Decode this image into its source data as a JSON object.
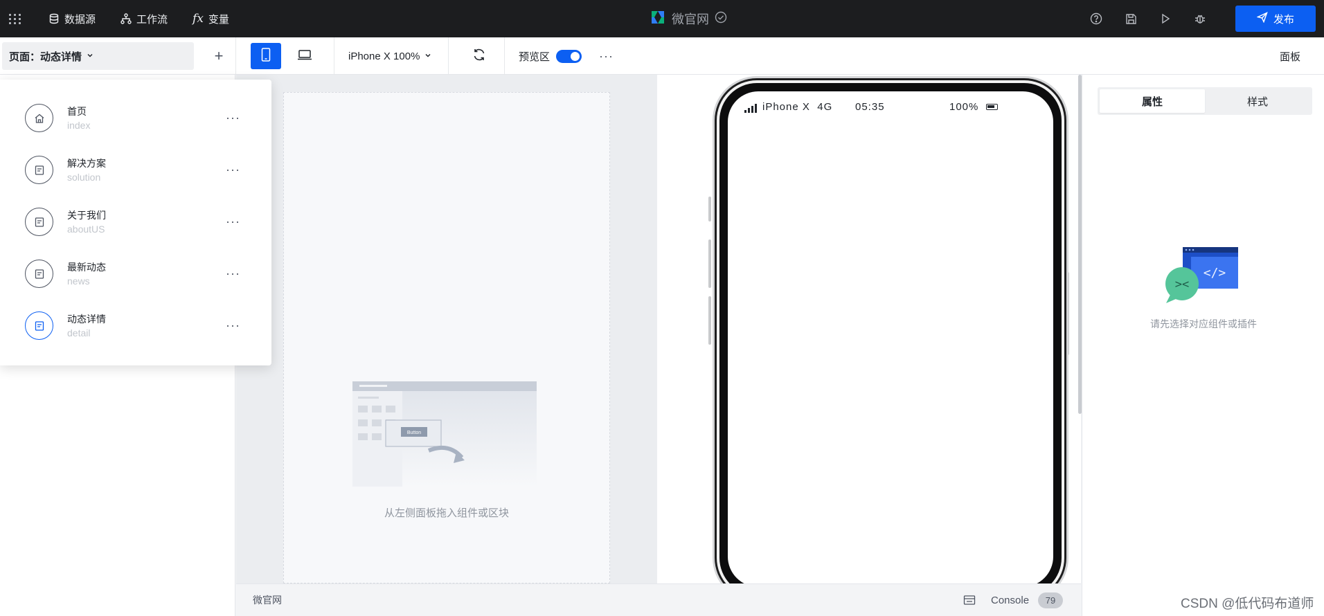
{
  "topbar": {
    "nav": [
      {
        "label": "数据源",
        "icon": "database-icon"
      },
      {
        "label": "工作流",
        "icon": "workflow-icon"
      },
      {
        "label": "变量",
        "icon": "fx-icon",
        "glyph": "fx"
      }
    ],
    "app_title": "微官网",
    "publish_label": "发布"
  },
  "toolbar": {
    "page_select": "页面：动态详情",
    "add_page": "+",
    "device": "iPhone X 100%",
    "preview_label": "预览区",
    "preview_enabled": true,
    "more": "···",
    "panel_label": "面板"
  },
  "pages": [
    {
      "title": "首页",
      "slug": "index",
      "icon": "home-icon"
    },
    {
      "title": "解决方案",
      "slug": "solution",
      "icon": "page-icon"
    },
    {
      "title": "关于我们",
      "slug": "aboutUS",
      "icon": "page-icon"
    },
    {
      "title": "最新动态",
      "slug": "news",
      "icon": "page-icon"
    },
    {
      "title": "动态详情",
      "slug": "detail",
      "icon": "page-icon",
      "active": true
    }
  ],
  "page_more": "···",
  "canvas": {
    "drop_hint": "从左侧面板拖入组件或区块",
    "illustration_button": "Button",
    "phone_status": {
      "carrier": "iPhone X",
      "network": "4G",
      "time": "05:35",
      "battery": "100%"
    }
  },
  "bottombar": {
    "app_name": "微官网",
    "console_label": "Console",
    "console_count": "79"
  },
  "right_panel": {
    "tabs": [
      {
        "label": "属性",
        "active": true
      },
      {
        "label": "样式",
        "active": false
      }
    ],
    "empty_hint": "请先选择对应组件或插件"
  },
  "watermark": "CSDN @低代码布道师",
  "colors": {
    "accent": "#0c5ff2",
    "topbar_bg": "#1c1d1f",
    "canvas_bg": "#ebedf0"
  }
}
